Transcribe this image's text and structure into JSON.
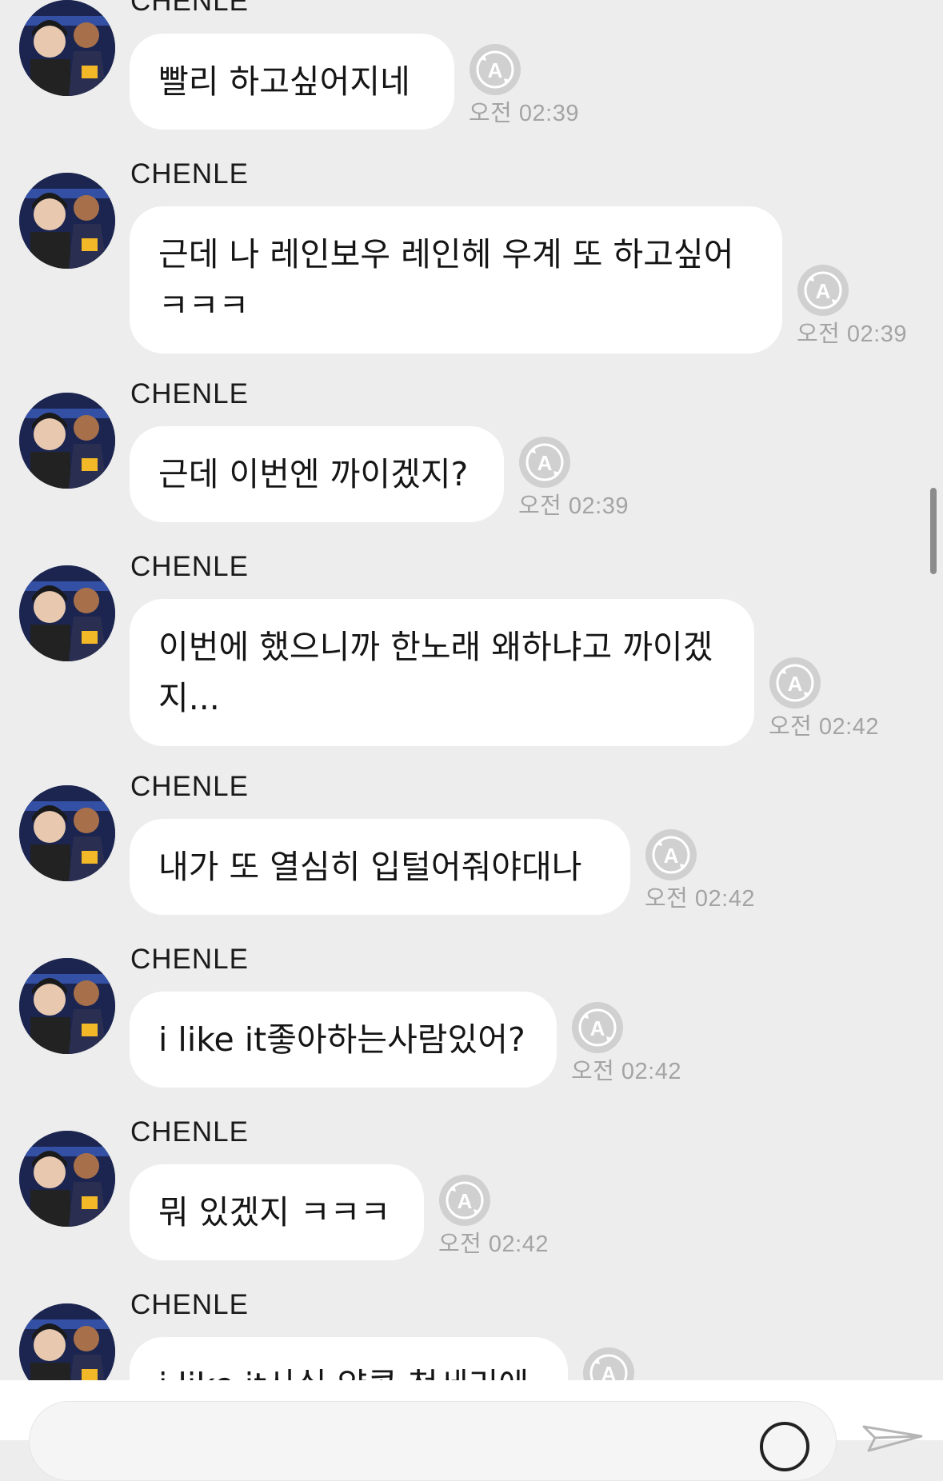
{
  "chat": {
    "messages": [
      {
        "sender": "CHENLE",
        "lines": [
          "빨리 하고싶어지네"
        ],
        "time": "오전 02:39"
      },
      {
        "sender": "CHENLE",
        "lines": [
          "근데 나 레인보우 레인헤 우계 또 하고싶어",
          "ㅋㅋㅋ"
        ],
        "time": "오전 02:39"
      },
      {
        "sender": "CHENLE",
        "lines": [
          "근데 이번엔 까이겠지?"
        ],
        "time": "오전 02:39"
      },
      {
        "sender": "CHENLE",
        "lines": [
          "이번에 했으니까 한노래 왜하냐고 까이겠",
          "지..."
        ],
        "time": "오전 02:42"
      },
      {
        "sender": "CHENLE",
        "lines": [
          "내가 또 열심히 입털어줘야대나"
        ],
        "time": "오전 02:42"
      },
      {
        "sender": "CHENLE",
        "lines": [
          "i like it좋아하는사람있어?"
        ],
        "time": "오전 02:42"
      },
      {
        "sender": "CHENLE",
        "lines": [
          "뭐 있겠지 ㅋㅋㅋ"
        ],
        "time": "오전 02:42"
      },
      {
        "sender": "CHENLE",
        "lines": [
          "i like it사실 약콩 청세리에"
        ],
        "time": ""
      }
    ]
  },
  "icons": {
    "read_receipt": "auto-translate-icon",
    "avatar": "profile-photo",
    "emoji": "emoji-icon",
    "send": "send-icon"
  },
  "colors": {
    "background": "#ededed",
    "bubble": "#ffffff",
    "time_text": "#a4a4a4",
    "icon_gray": "#c4c4c4"
  }
}
